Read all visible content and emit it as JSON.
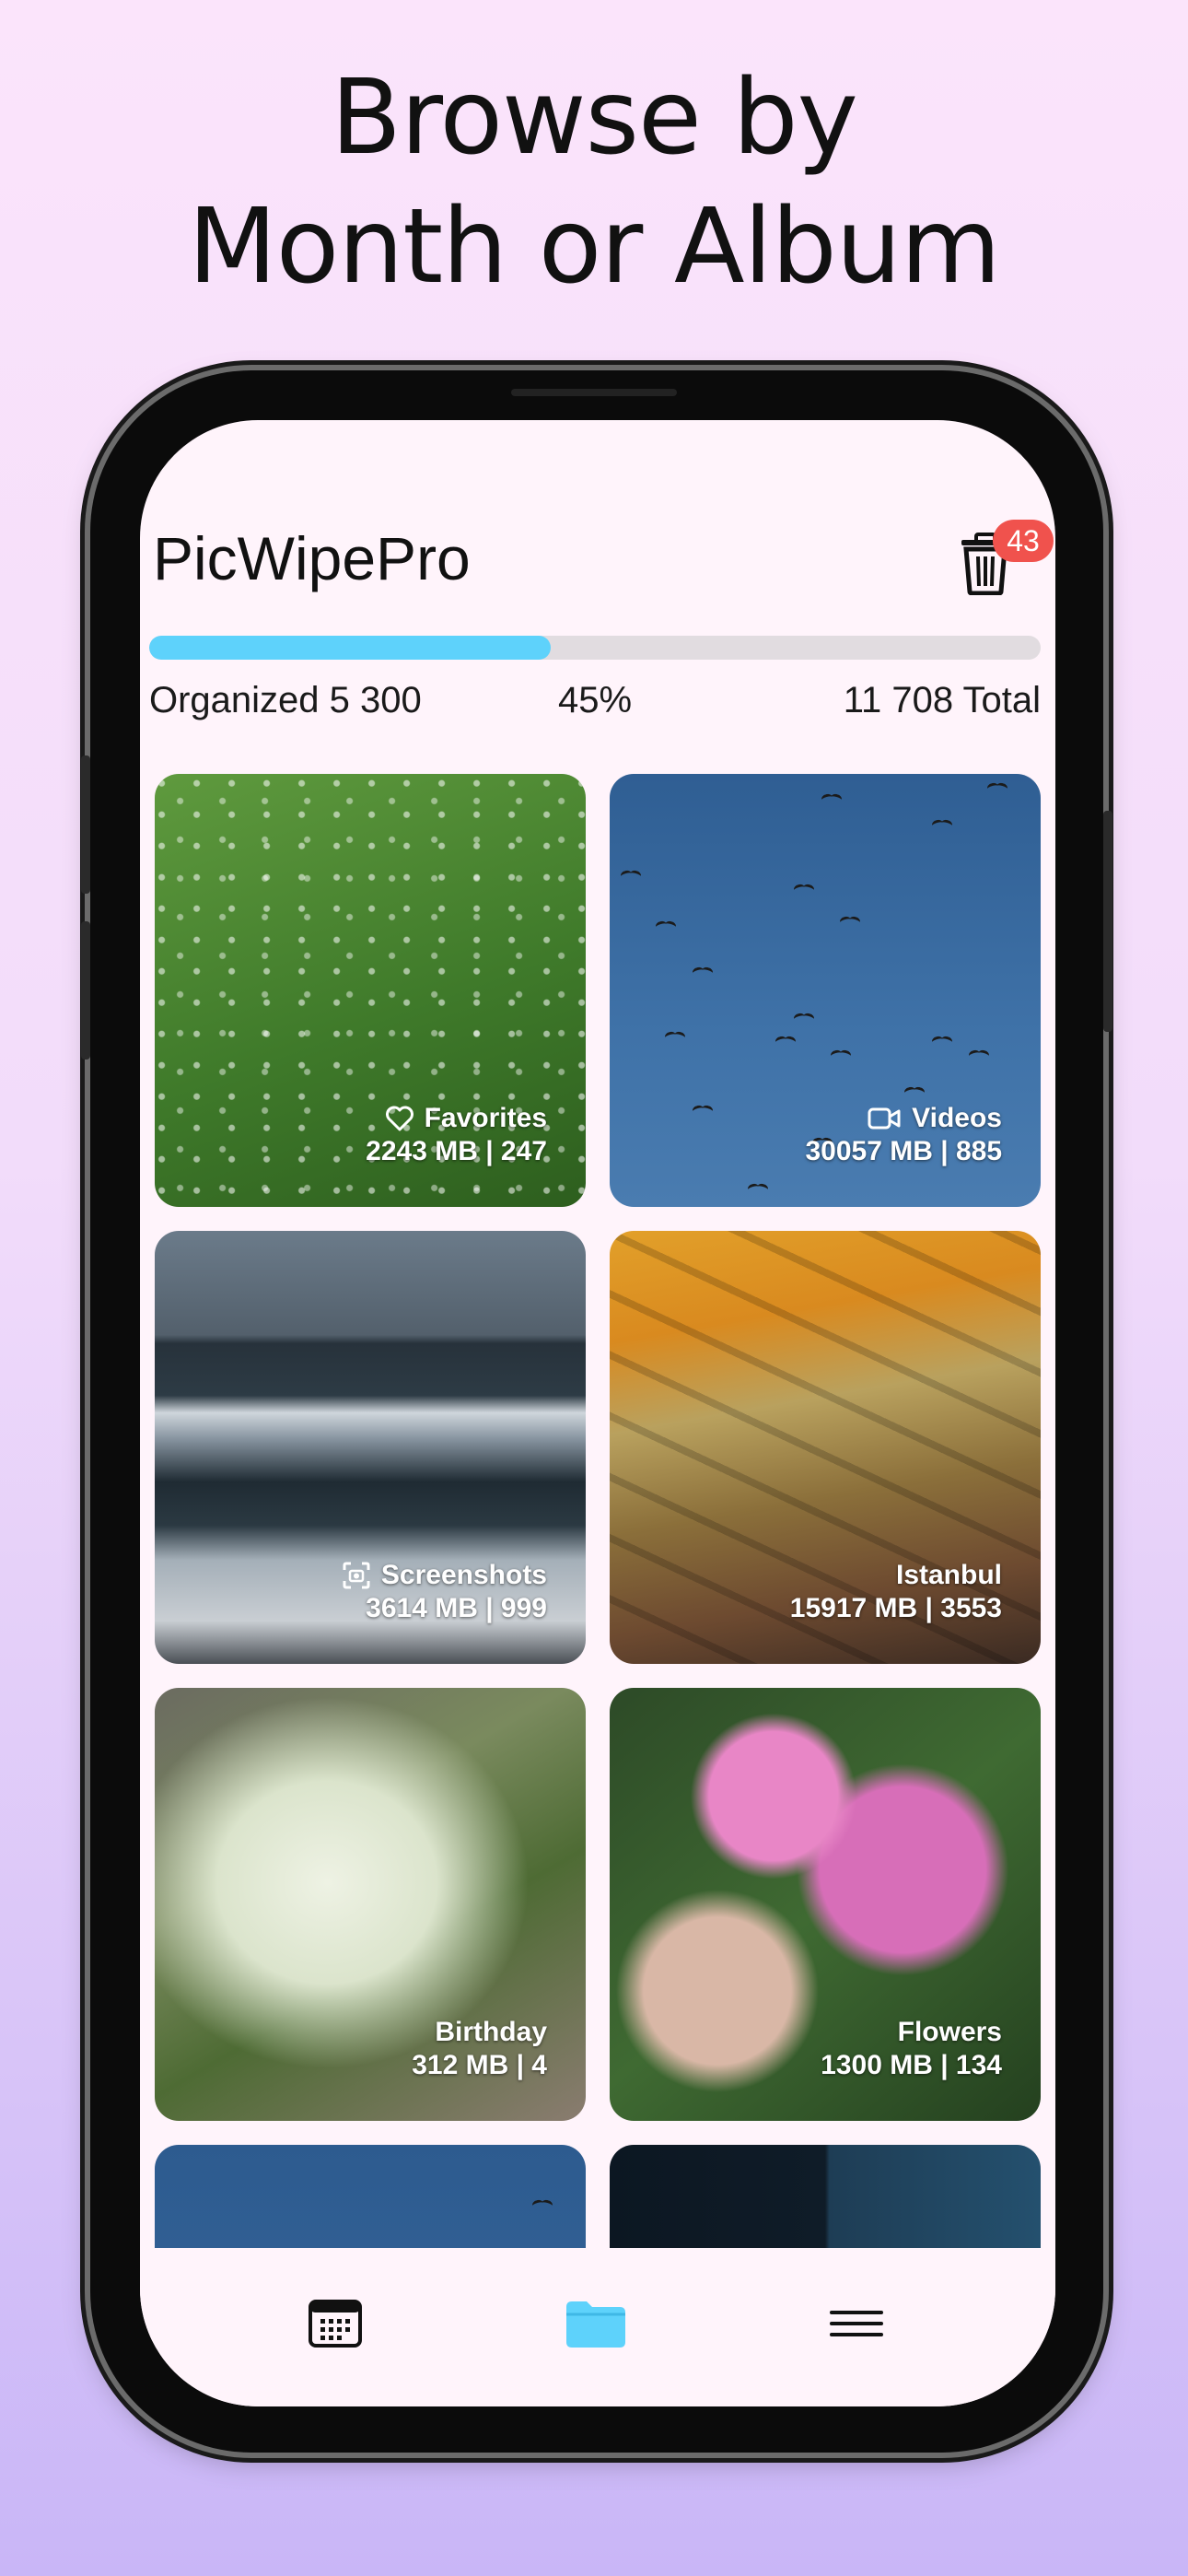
{
  "headline": {
    "line1": "Browse by",
    "line2": "Month or Album"
  },
  "app": {
    "title": "PicWipePro",
    "trash_badge": "43",
    "progress": {
      "fraction": 0.45,
      "organized_label": "Organized 5 300",
      "percent_label": "45%",
      "total_label": "11 708 Total"
    },
    "colors": {
      "accent": "#5ed2fb",
      "badge": "#f0524d",
      "screen_bg": "#fff4fb"
    }
  },
  "albums": [
    {
      "name": "Favorites",
      "icon": "heart-icon",
      "stats": "2243 MB | 247"
    },
    {
      "name": "Videos",
      "icon": "video-camera-icon",
      "stats": "30057 MB | 885"
    },
    {
      "name": "Screenshots",
      "icon": "screenshot-icon",
      "stats": "3614 MB | 999"
    },
    {
      "name": "Istanbul",
      "icon": "",
      "stats": "15917 MB | 3553"
    },
    {
      "name": "Birthday",
      "icon": "",
      "stats": "312 MB | 4"
    },
    {
      "name": "Flowers",
      "icon": "",
      "stats": "1300 MB | 134"
    }
  ],
  "tabbar": {
    "tabs": [
      {
        "name": "calendar-tab",
        "icon": "calendar-icon",
        "active": false
      },
      {
        "name": "albums-tab",
        "icon": "folder-icon",
        "active": true
      },
      {
        "name": "menu-tab",
        "icon": "hamburger-menu-icon",
        "active": false
      }
    ]
  }
}
